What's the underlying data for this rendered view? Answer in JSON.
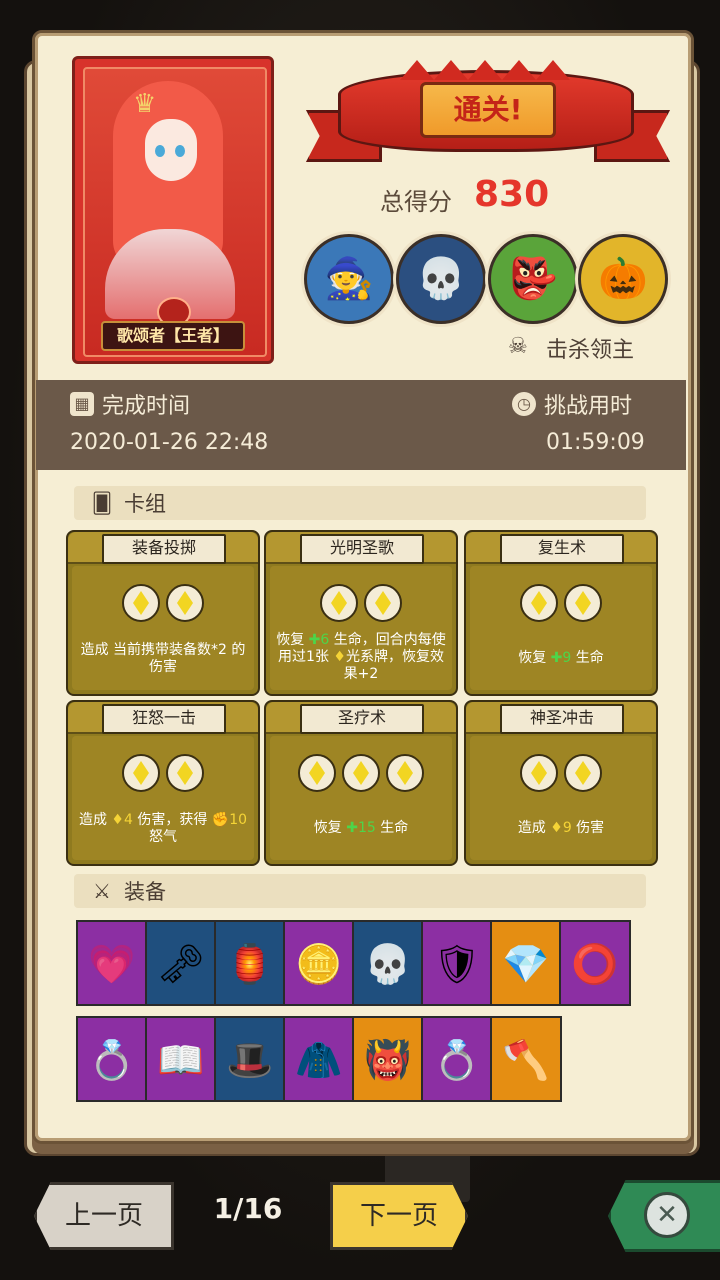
{
  "portrait": {
    "label": "歌颂者【王者】"
  },
  "banner": {
    "title": "通关!"
  },
  "score": {
    "label": "总得分",
    "value": "830"
  },
  "bosses": [
    {
      "name": "wizard-boss-icon",
      "glyph": "🧙",
      "bg": "#3b78b8"
    },
    {
      "name": "undead-king-boss-icon",
      "glyph": "💀",
      "bg": "#2b4f80"
    },
    {
      "name": "goblin-boss-icon",
      "glyph": "👺",
      "bg": "#5aa43a"
    },
    {
      "name": "pumpkin-boss-icon",
      "glyph": "🎃",
      "bg": "#e2b52a"
    }
  ],
  "kill_label": "击杀领主",
  "time": {
    "finish_label": "完成时间",
    "finish_value": "2020-01-26 22:48",
    "duration_label": "挑战用时",
    "duration_value": "01:59:09"
  },
  "deck": {
    "label": "卡组",
    "cards": [
      {
        "title": "装备投掷",
        "gems": 2,
        "desc": [
          {
            "t": "造成 当前携带装备数*2 的伤害"
          }
        ]
      },
      {
        "title": "光明圣歌",
        "gems": 2,
        "desc": [
          {
            "t": "恢复 "
          },
          {
            "t": "✚6",
            "c": "green"
          },
          {
            "t": " 生命，回合内每使用过1张 "
          },
          {
            "t": "♦",
            "c": "gold"
          },
          {
            "t": "光系牌，恢复效果+2"
          }
        ]
      },
      {
        "title": "复生术",
        "gems": 2,
        "desc": [
          {
            "t": "恢复 "
          },
          {
            "t": "✚9",
            "c": "green"
          },
          {
            "t": " 生命"
          }
        ]
      },
      {
        "title": "狂怒一击",
        "gems": 2,
        "desc": [
          {
            "t": "造成 "
          },
          {
            "t": "♦4",
            "c": "gold"
          },
          {
            "t": " 伤害，获得 "
          },
          {
            "t": "✊10",
            "c": "gold"
          },
          {
            "t": " 怒气"
          }
        ]
      },
      {
        "title": "圣疗术",
        "gems": 3,
        "desc": [
          {
            "t": "恢复 "
          },
          {
            "t": "✚15",
            "c": "green"
          },
          {
            "t": " 生命"
          }
        ]
      },
      {
        "title": "神圣冲击",
        "gems": 2,
        "desc": [
          {
            "t": "造成 "
          },
          {
            "t": "♦9",
            "c": "gold"
          },
          {
            "t": " 伤害"
          }
        ]
      }
    ]
  },
  "equipment": {
    "label": "装备",
    "row1": [
      {
        "name": "heart-locket-icon",
        "glyph": "💗",
        "color": "purple"
      },
      {
        "name": "golden-key-icon",
        "glyph": "🗝",
        "color": "blue"
      },
      {
        "name": "lantern-icon",
        "glyph": "🏮",
        "color": "blue"
      },
      {
        "name": "gold-coin-icon",
        "glyph": "🪙",
        "color": "purple"
      },
      {
        "name": "skull-icon",
        "glyph": "💀",
        "color": "blue"
      },
      {
        "name": "heart-shield-icon",
        "glyph": "🛡",
        "color": "purple"
      },
      {
        "name": "gem-icon",
        "glyph": "💎",
        "color": "orange"
      },
      {
        "name": "red-ring-icon",
        "glyph": "⭕",
        "color": "purple"
      }
    ],
    "row2": [
      {
        "name": "blood-ring-icon",
        "glyph": "💍",
        "color": "purple"
      },
      {
        "name": "skull-book-icon",
        "glyph": "📖",
        "color": "purple"
      },
      {
        "name": "wizard-hat-icon",
        "glyph": "🎩",
        "color": "blue"
      },
      {
        "name": "cloak-icon",
        "glyph": "🧥",
        "color": "purple"
      },
      {
        "name": "demon-armor-icon",
        "glyph": "👹",
        "color": "orange"
      },
      {
        "name": "gold-ring-icon",
        "glyph": "💍",
        "color": "purple"
      },
      {
        "name": "axe-icon",
        "glyph": "🪓",
        "color": "orange"
      }
    ]
  },
  "nav": {
    "prev": "上一页",
    "page": "1/16",
    "next": "下一页"
  },
  "colors": {
    "accent": "#e5362b",
    "paper": "#f6eed4",
    "band": "#6b5949"
  }
}
